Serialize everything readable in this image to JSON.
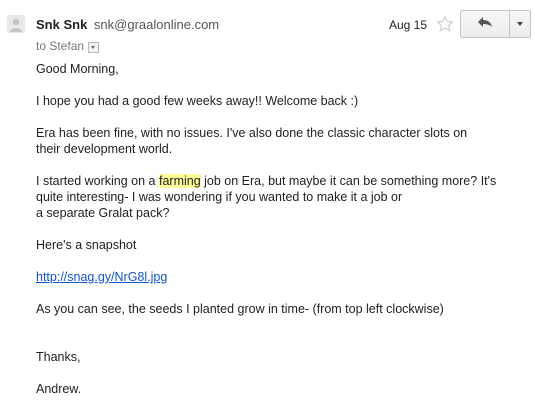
{
  "header": {
    "sender_name": "Snk Snk",
    "sender_email": "snk@graalonline.com",
    "recipient": "to Stefan",
    "date": "Aug 15",
    "icons": {
      "avatar": "default-avatar-icon",
      "star": "star-outline-icon",
      "reply": "reply-arrow-icon",
      "more": "chevron-down-icon"
    }
  },
  "body": {
    "greeting": "Good Morning,",
    "welcome": "I hope you had a good few weeks away!! Welcome back :)",
    "era_line1": "Era has been fine, with no issues. I've also done the classic character slots on",
    "era_line2": "their development world.",
    "started_before": "I started working on a ",
    "highlight_word": "farming",
    "started_after": " job on Era, but maybe it can be something more? It's",
    "started_line2": "quite interesting- I was wondering if you wanted to make it a job or",
    "started_line3": "a separate Gralat pack?",
    "snapshot": "Here's a snapshot",
    "link": "http://snag.gy/NrG8l.jpg",
    "seeds": "As you can see, the seeds I planted grow in time- (from top left clockwise)",
    "thanks": "Thanks,",
    "signature": "Andrew."
  },
  "colors": {
    "link": "#1155cc",
    "highlight": "#ffff99",
    "text": "#222222",
    "muted": "#777777"
  }
}
